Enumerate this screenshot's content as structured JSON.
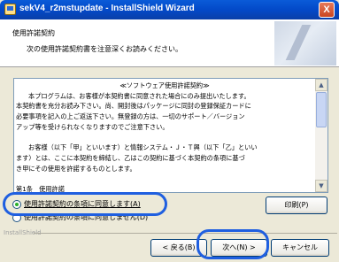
{
  "window": {
    "title": "sekV4_r2mstupdate - InstallShield Wizard",
    "close_label": "X"
  },
  "header": {
    "title": "使用許諾契約",
    "subtitle": "次の使用許諾契約書を注意深くお読みください。"
  },
  "license": {
    "lines": [
      "≪ソフトウェア使用許諾契約≫",
      "本プログラムは、お客様が本契約書に同意された場合にのみ提出いたします。",
      "本契約書を充分お読み下さい。尚、開封後はパッケージに同封の登録保証カードに",
      "必要事項を記入の上ご返送下さい。無登録の方は、一切のサポート／バージョン",
      "アップ等を受けられなくなりますのでご注意下さい。",
      "",
      "お客様（以下「甲」といいます）と情報システム・Ｊ・Ｔ興（以下「乙」といい",
      "ます）とは、ここに本契約を締結し、乙はこの契約に基づく本契約の条項に基づ",
      "き甲にその使用を許諾するものとします。",
      "",
      "第1条　使用許諾"
    ],
    "scroll_up": "▲",
    "scroll_down": "▼"
  },
  "options": {
    "accept": "使用許諾契約の条項に同意します(A)",
    "decline": "使用許諾契約の条項に同意しません(D)"
  },
  "buttons": {
    "print": "印刷(P)",
    "back": "< 戻る(B)",
    "next": "次へ(N) >",
    "cancel": "キャンセル"
  },
  "footer": {
    "brand": "InstallShield"
  },
  "colors": {
    "highlight": "#1f5fe0",
    "titlebar": "#0349c8"
  }
}
